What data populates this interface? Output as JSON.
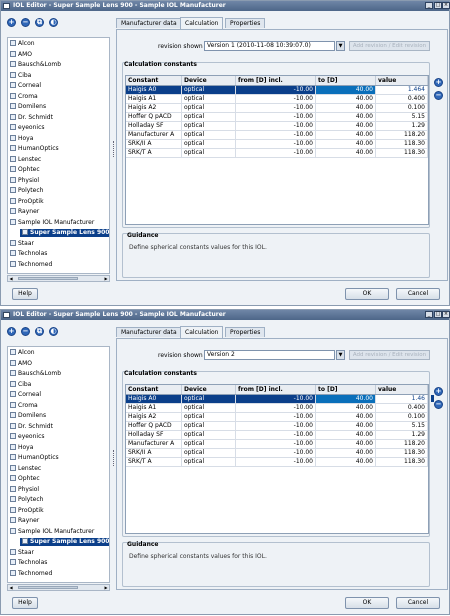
{
  "windows": [
    {
      "title": "IOL Editor - Super Sample Lens 900 - Sample IOL Manufacturer",
      "tree_items": [
        "Alcon",
        "AMO",
        "Bausch&Lomb",
        "Ciba",
        "Corneal",
        "Croma",
        "Domilens",
        "Dr. Schmidt",
        "eyeonics",
        "Hoya",
        "HumanOptics",
        "Lenstec",
        "Ophtec",
        "Physiol",
        "Polytech",
        "ProOptik",
        "Rayner",
        "Sample IOL Manufacturer",
        "Super Sample Lens 900",
        "Staar",
        "Technolas",
        "Technomed"
      ],
      "tabs": [
        "Manufacturer data",
        "Calculation",
        "Properties"
      ],
      "active_tab": "Calculation",
      "revision_label": "revision shown",
      "revision_value": "Version 1 (2010-11-08 10:39:07.0)",
      "revision_button": "Add revision / Edit revision",
      "calc_title": "Calculation constants",
      "columns": [
        "Constant",
        "Device",
        "from [D] incl.",
        "to [D]",
        "value"
      ],
      "rows": [
        [
          "Haigis A0",
          "optical",
          "-10.00",
          "40.00",
          "1.464"
        ],
        [
          "Haigis A1",
          "optical",
          "-10.00",
          "40.00",
          "0.400"
        ],
        [
          "Haigis A2",
          "optical",
          "-10.00",
          "40.00",
          "0.100"
        ],
        [
          "Hoffer Q pACD",
          "optical",
          "-10.00",
          "40.00",
          "5.15"
        ],
        [
          "Holladay SF",
          "optical",
          "-10.00",
          "40.00",
          "1.29"
        ],
        [
          "Manufacturer A",
          "optical",
          "-10.00",
          "40.00",
          "118.20"
        ],
        [
          "SRK/II A",
          "optical",
          "-10.00",
          "40.00",
          "118.30"
        ],
        [
          "SRK/T A",
          "optical",
          "-10.00",
          "40.00",
          "118.30"
        ]
      ],
      "guidance_title": "Guidance",
      "guidance_text": "Define spherical constants values for this IOL.",
      "help_label": "Help",
      "ok_label": "OK",
      "cancel_label": "Cancel"
    },
    {
      "title": "IOL Editor - Super Sample Lens 900 - Sample IOL Manufacturer",
      "tree_items": [
        "Alcon",
        "AMO",
        "Bausch&Lomb",
        "Ciba",
        "Corneal",
        "Croma",
        "Domilens",
        "Dr. Schmidt",
        "eyeonics",
        "Hoya",
        "HumanOptics",
        "Lenstec",
        "Ophtec",
        "Physiol",
        "Polytech",
        "ProOptik",
        "Rayner",
        "Sample IOL Manufacturer",
        "Super Sample Lens 900",
        "Staar",
        "Technolas",
        "Technomed"
      ],
      "tabs": [
        "Manufacturer data",
        "Calculation",
        "Properties"
      ],
      "active_tab": "Calculation",
      "revision_label": "revision shown",
      "revision_value": "Version 2",
      "revision_button": "Add revision / Edit revision",
      "calc_title": "Calculation constants",
      "columns": [
        "Constant",
        "Device",
        "from [D] incl.",
        "to [D]",
        "value"
      ],
      "rows": [
        [
          "Haigis A0",
          "optical",
          "-10.00",
          "40.00",
          "1.46"
        ],
        [
          "Haigis A1",
          "optical",
          "-10.00",
          "40.00",
          "0.400"
        ],
        [
          "Haigis A2",
          "optical",
          "-10.00",
          "40.00",
          "0.100"
        ],
        [
          "Hoffer Q pACD",
          "optical",
          "-10.00",
          "40.00",
          "5.15"
        ],
        [
          "Holladay SF",
          "optical",
          "-10.00",
          "40.00",
          "1.29"
        ],
        [
          "Manufacturer A",
          "optical",
          "-10.00",
          "40.00",
          "118.20"
        ],
        [
          "SRK/II A",
          "optical",
          "-10.00",
          "40.00",
          "118.30"
        ],
        [
          "SRK/T A",
          "optical",
          "-10.00",
          "40.00",
          "118.30"
        ]
      ],
      "guidance_title": "Guidance",
      "guidance_text": "Define spherical constants values for this IOL.",
      "help_label": "Help",
      "ok_label": "OK",
      "cancel_label": "Cancel"
    }
  ]
}
